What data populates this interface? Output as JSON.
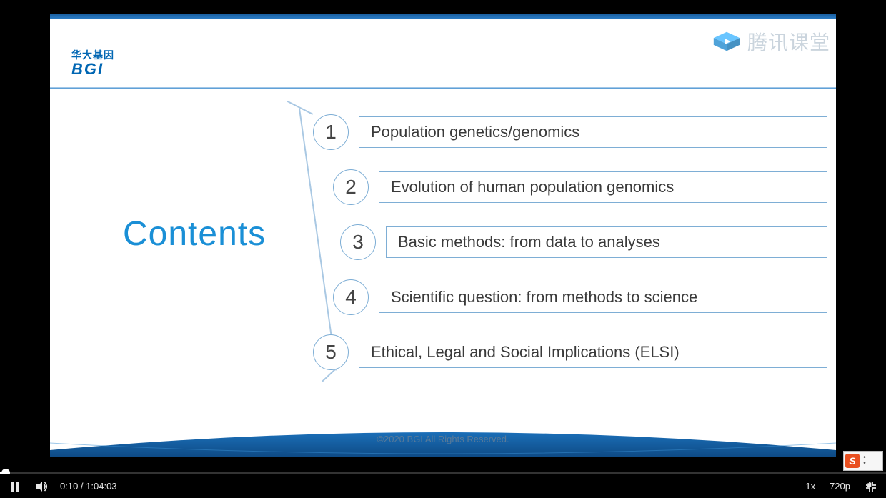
{
  "watermark": {
    "text": "腾讯课堂"
  },
  "bgi_logo": {
    "cn": "华大基因",
    "en": "BGI"
  },
  "slide": {
    "title": "Contents",
    "items": [
      {
        "num": "1",
        "label": "Population genetics/genomics"
      },
      {
        "num": "2",
        "label": "Evolution of human population genomics"
      },
      {
        "num": "3",
        "label": "Basic methods: from data to analyses"
      },
      {
        "num": "4",
        "label": "Scientific question: from methods to science"
      },
      {
        "num": "5",
        "label": "Ethical, Legal and Social Implications (ELSI)"
      }
    ],
    "copyright": "©2020 BGI All Rights Reserved."
  },
  "player": {
    "current_time": "0:10",
    "total_time": "1:04:03",
    "time_separator": " / ",
    "speed": "1x",
    "resolution": "720p"
  },
  "ime": {
    "badge": "S"
  }
}
